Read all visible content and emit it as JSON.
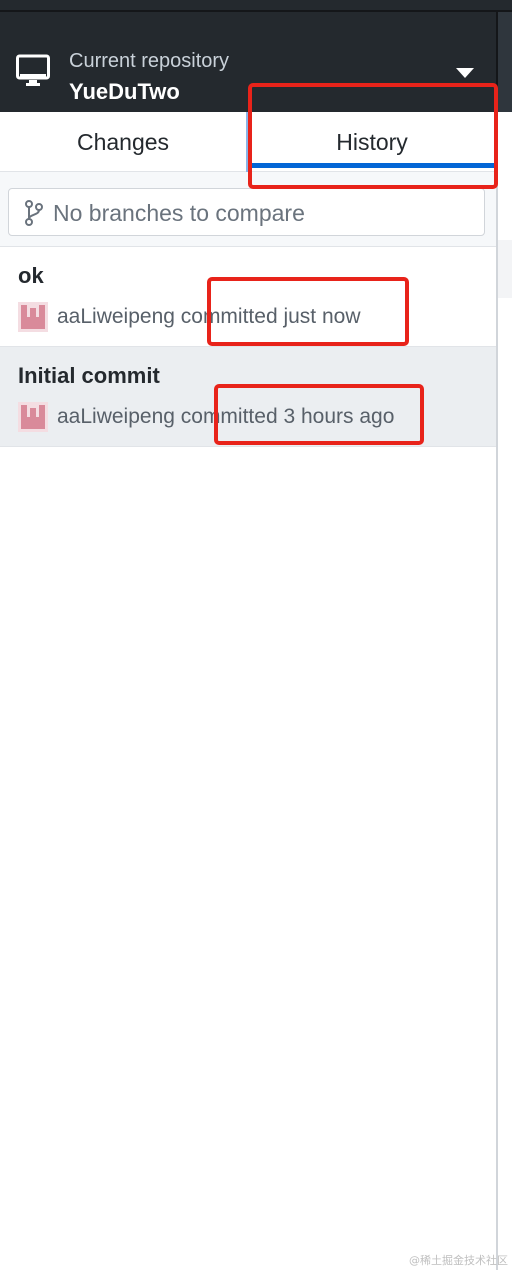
{
  "header": {
    "label": "Current repository",
    "repo_name": "YueDuTwo"
  },
  "tabs": [
    {
      "label": "Changes",
      "selected": false
    },
    {
      "label": "History",
      "selected": true
    }
  ],
  "branch_filter": {
    "placeholder": "No branches to compare"
  },
  "commits": [
    {
      "title": "ok",
      "author_line": "aaLiweipeng committed just now",
      "selected": false
    },
    {
      "title": "Initial commit",
      "author_line": "aaLiweipeng committed 3 hours ago",
      "selected": true
    }
  ],
  "annotation_color": "#e8231a",
  "watermark": "@稀土掘金技术社区",
  "icons": {
    "repo": "monitor-icon",
    "dropdown": "triangle-down-icon",
    "branch": "git-branch-icon",
    "avatar": "identicon-avatar"
  },
  "colors": {
    "header_bg": "#24292e",
    "accent": "#0366d6",
    "selected_row": "#ebeef1"
  }
}
